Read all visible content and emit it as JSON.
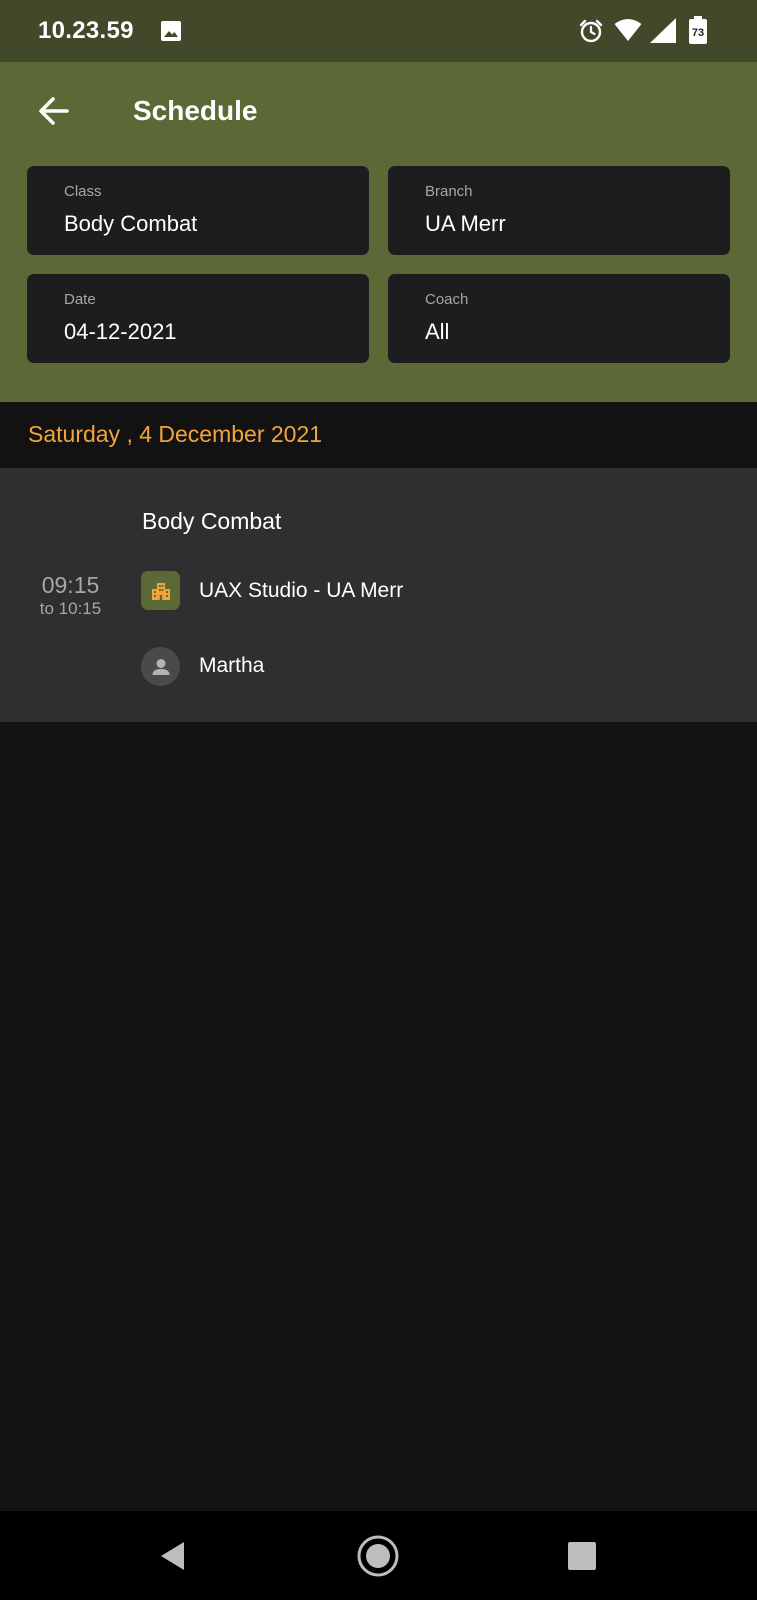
{
  "status_bar": {
    "time": "10.23.59",
    "battery_level": "73",
    "icons": [
      "image-icon",
      "alarm-icon",
      "wifi-icon",
      "signal-icon",
      "battery-icon"
    ]
  },
  "header": {
    "title": "Schedule",
    "back_icon": "arrow-back-icon",
    "background_color": "#5b6936"
  },
  "filters": {
    "class": {
      "label": "Class",
      "value": "Body Combat"
    },
    "branch": {
      "label": "Branch",
      "value": "UA Merr"
    },
    "date": {
      "label": "Date",
      "value": "04-12-2021"
    },
    "coach": {
      "label": "Coach",
      "value": "All"
    }
  },
  "schedule": {
    "date_heading": "Saturday , 4 December 2021",
    "accent_color": "#f2a43a",
    "sessions": [
      {
        "start": "09:15",
        "end": "to 10:15",
        "title": "Body Combat",
        "location": "UAX Studio - UA Merr",
        "location_icon": "building-icon",
        "coach": "Martha",
        "coach_icon": "person-icon"
      }
    ]
  },
  "navigation_bar": {
    "icons": [
      "back-triangle-icon",
      "home-circle-icon",
      "recents-square-icon"
    ]
  }
}
